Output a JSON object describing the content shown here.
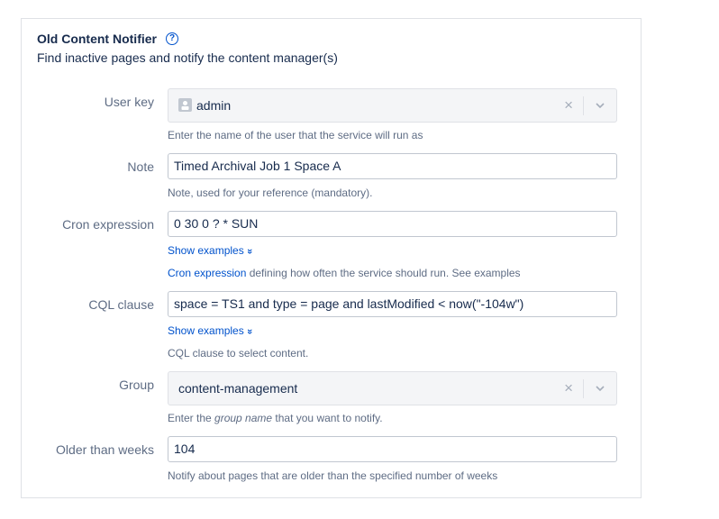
{
  "header": {
    "title": "Old Content Notifier",
    "help_glyph": "?",
    "subtitle": "Find inactive pages and notify the content manager(s)"
  },
  "fields": {
    "user_key": {
      "label": "User key",
      "value": "admin",
      "clear_glyph": "×",
      "help": "Enter the name of the user that the service will run as"
    },
    "note": {
      "label": "Note",
      "value": "Timed Archival Job 1 Space A",
      "help": "Note, used for your reference (mandatory)."
    },
    "cron": {
      "label": "Cron expression",
      "value": "0 30 0 ? * SUN",
      "show_examples": "Show examples",
      "examples_glyph": "»",
      "help_link": "Cron expression",
      "help_rest": " defining how often the service should run. See examples"
    },
    "cql": {
      "label": "CQL clause",
      "value": "space = TS1 and type = page and lastModified < now(\"-104w\")",
      "show_examples": "Show examples",
      "examples_glyph": "»",
      "help": "CQL clause to select content."
    },
    "group": {
      "label": "Group",
      "value": "content-management",
      "clear_glyph": "×",
      "help_prefix": "Enter the ",
      "help_em": "group name",
      "help_suffix": " that you want to notify."
    },
    "older_than": {
      "label": "Older than weeks",
      "value": "104",
      "help": "Notify about pages that are older than the specified number of weeks"
    }
  },
  "colors": {
    "link": "#0052CC",
    "label": "#5E6C84",
    "text": "#172B4D",
    "border": "#C1C7D0",
    "select_bg": "#F4F5F7"
  },
  "icons": {
    "help": "question-circle-icon",
    "user": "user-avatar-icon",
    "clear": "clear-icon",
    "dropdown": "chevron-down-icon",
    "expand": "double-chevron-down-icon"
  }
}
